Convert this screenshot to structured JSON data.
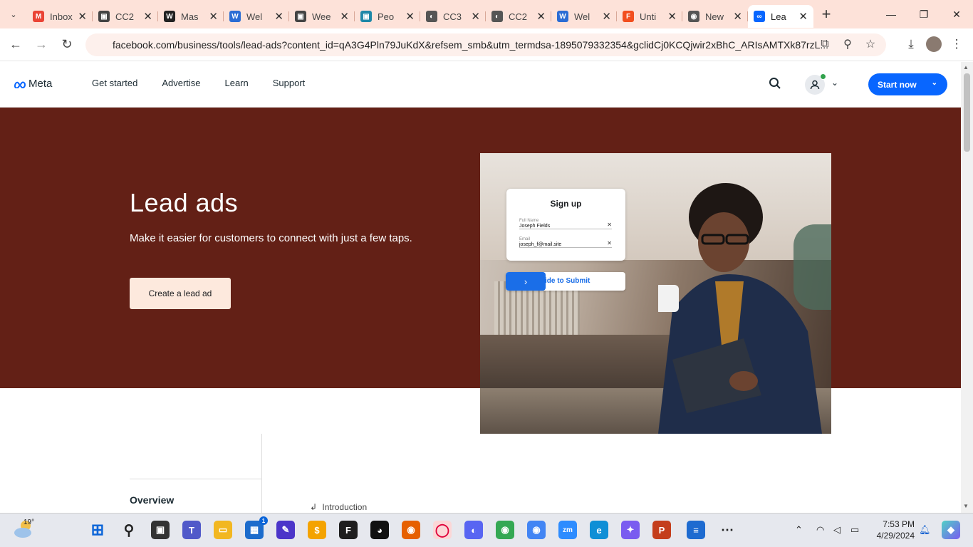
{
  "browser": {
    "tabs": [
      {
        "title": "Inbox",
        "icon": "gmail-icon",
        "color": "#ea4335",
        "glyph": "M"
      },
      {
        "title": "CC2",
        "icon": "contact-card-icon",
        "color": "#444444",
        "glyph": "▣"
      },
      {
        "title": "Mas",
        "icon": "w-app-icon",
        "color": "#222222",
        "glyph": "W"
      },
      {
        "title": "Wel",
        "icon": "word-doc-icon",
        "color": "#2b6cd4",
        "glyph": "W"
      },
      {
        "title": "Wee",
        "icon": "contact-card-icon",
        "color": "#444444",
        "glyph": "▣"
      },
      {
        "title": "Peo",
        "icon": "people-icon",
        "color": "#1e88a8",
        "glyph": "▣"
      },
      {
        "title": "CC3",
        "icon": "globe-icon",
        "color": "#555555",
        "glyph": "◐"
      },
      {
        "title": "CC2",
        "icon": "globe-icon",
        "color": "#555555",
        "glyph": "◐"
      },
      {
        "title": "Wel",
        "icon": "word-doc-icon",
        "color": "#2b6cd4",
        "glyph": "W"
      },
      {
        "title": "Unti",
        "icon": "figma-icon",
        "color": "#f24e1e",
        "glyph": "F"
      },
      {
        "title": "New",
        "icon": "chrome-icon",
        "color": "#555555",
        "glyph": "◉"
      },
      {
        "title": "Lea",
        "icon": "meta-icon",
        "color": "#0866ff",
        "glyph": "∞",
        "active": true
      }
    ],
    "url": "facebook.com/business/tools/lead-ads?content_id=qA3G4Pln79JuKdX&refsem_smb&utm_termdsa-1895079332354&gclidCj0KCQjwir2xBhC_ARIsAMTXk87rzL..."
  },
  "nav": {
    "brand": "Meta",
    "links": [
      "Get started",
      "Advertise",
      "Learn",
      "Support"
    ],
    "start_label": "Start now"
  },
  "hero": {
    "title": "Lead ads",
    "subtitle": "Make it easier for customers to connect with just a few taps.",
    "cta": "Create a lead ad",
    "background": "#632016"
  },
  "mockup": {
    "title": "Sign up",
    "name_label": "Full Name",
    "name_value": "Joseph Fields",
    "email_label": "Email",
    "email_value": "joseph_f@mail.site",
    "slide_label": "Slide to Submit",
    "slide_visible": "ide to Submit"
  },
  "content": {
    "overview": "Overview",
    "intro": "Introduction"
  },
  "taskbar": {
    "temperature": "19°",
    "time": "7:53 PM",
    "date": "4/29/2024",
    "badge": "1"
  }
}
